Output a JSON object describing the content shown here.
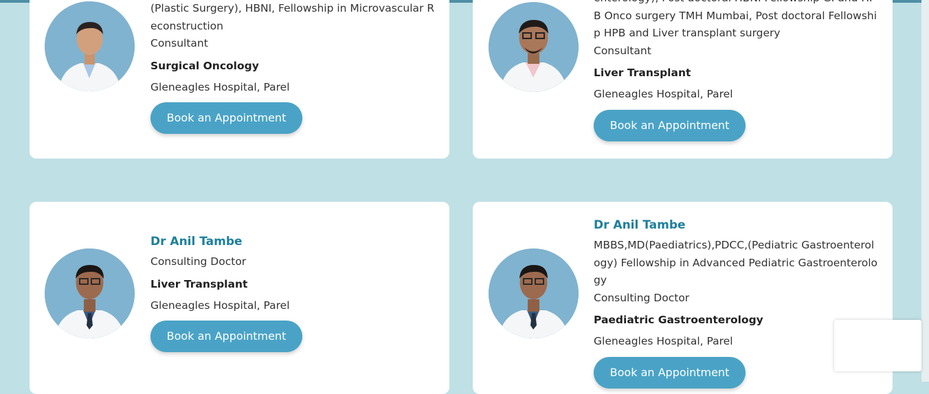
{
  "button_label": "Book an Appointment",
  "colors": {
    "background": "#bfe0e5",
    "accent": "#4aa3c6",
    "name": "#1d7f9c"
  },
  "cards": [
    {
      "quals": "(Plastic Surgery), HBNI, Fellowship in Microvascular Reconstruction",
      "designation": "Consultant",
      "speciality": "Surgical Oncology",
      "location": "Gleneagles Hospital, Parel"
    },
    {
      "quals": "enterology), Post doctoral HBNI Fellowship GI and HPB Onco surgery TMH Mumbai, Post doctoral Fellowship HPB and Liver transplant surgery",
      "designation": "Consultant",
      "speciality": "Liver Transplant",
      "location": "Gleneagles Hospital, Parel"
    },
    {
      "name": "Dr Anil Tambe",
      "designation": "Consulting Doctor",
      "speciality": "Liver Transplant",
      "location": "Gleneagles Hospital, Parel"
    },
    {
      "name": "Dr Anil Tambe",
      "quals": "MBBS,MD(Paediatrics),PDCC,(Pediatric Gastroenterology) Fellowship in Advanced Pediatric Gastroenterology",
      "designation": "Consulting Doctor",
      "speciality": "Paediatric Gastroenterology",
      "location": "Gleneagles Hospital, Parel"
    }
  ]
}
